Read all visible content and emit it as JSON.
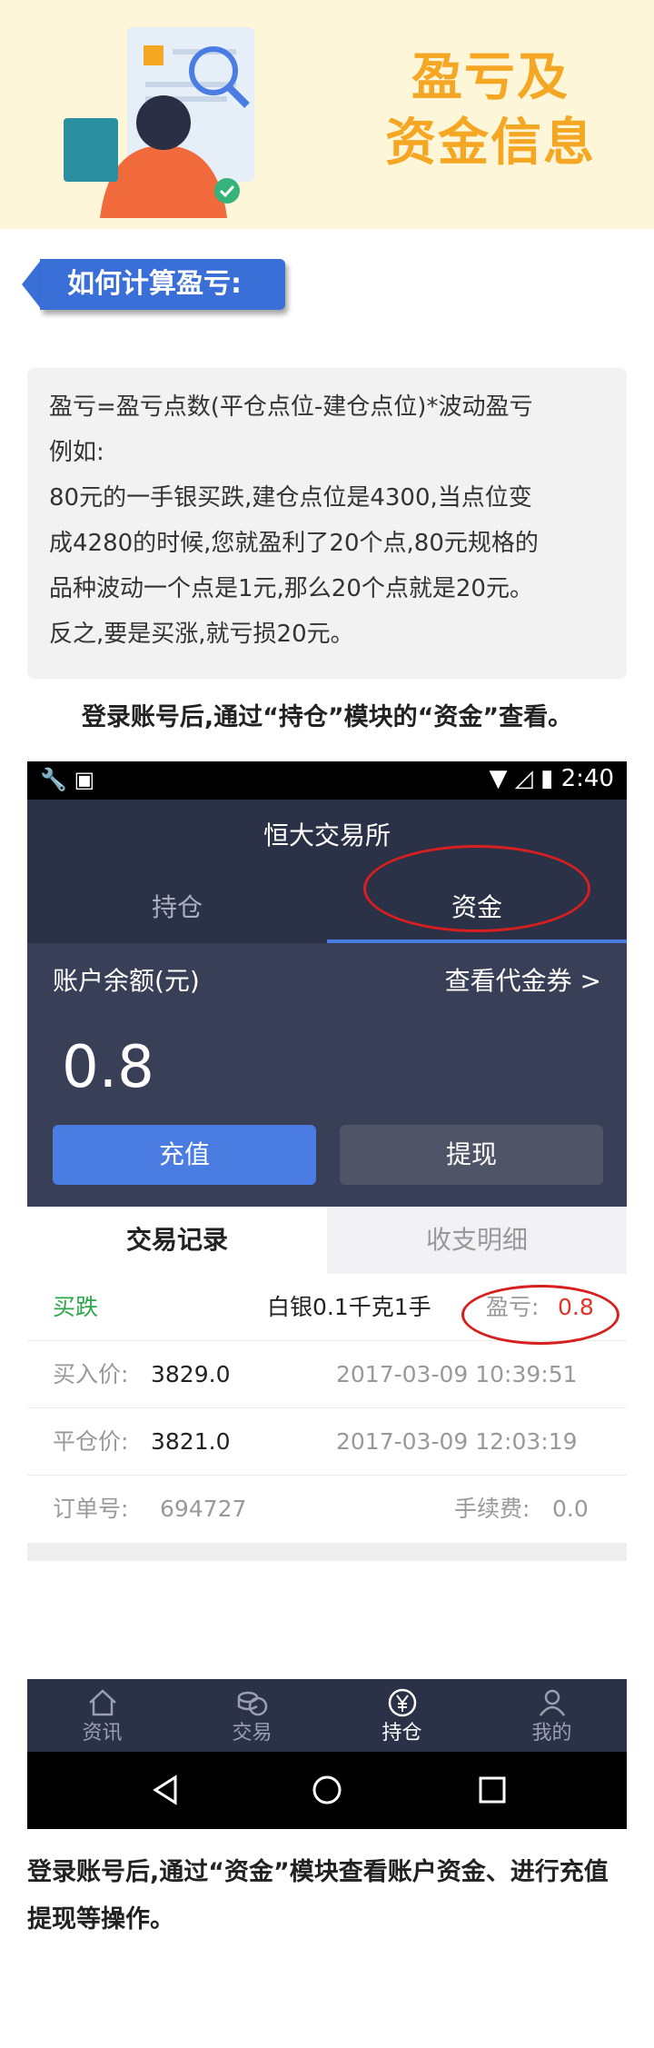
{
  "banner": {
    "title_line1": "盈亏及",
    "title_line2": "资金信息"
  },
  "section": {
    "label": "如何计算盈亏:"
  },
  "explain": {
    "lines": [
      "盈亏=盈亏点数(平仓点位-建仓点位)*波动盈亏",
      "例如:",
      "80元的一手银买跌,建仓点位是4300,当点位变",
      "成4280的时候,您就盈利了20个点,80元规格的",
      "品种波动一个点是1元,那么20个点就是20元。",
      "反之,要是买涨,就亏损20元。"
    ]
  },
  "caption1": "登录账号后,通过“持仓”模块的“资金”查看。",
  "phone": {
    "status": {
      "time": "2:40"
    },
    "app_title": "恒大交易所",
    "tabs": [
      {
        "label": "持仓"
      },
      {
        "label": "资金"
      }
    ],
    "account": {
      "balance_label": "账户余额(元)",
      "voucher_link": "查看代金券 >",
      "balance": "0.8",
      "recharge": "充值",
      "withdraw": "提现"
    },
    "subtabs": [
      {
        "label": "交易记录"
      },
      {
        "label": "收支明细"
      }
    ],
    "record": {
      "direction": "买跌",
      "product": "白银0.1千克1手",
      "pnl_label": "盈亏:",
      "pnl_value": "0.8",
      "buy_label": "买入价:",
      "buy_price": "3829.0",
      "buy_time": "2017-03-09 10:39:51",
      "close_label": "平仓价:",
      "close_price": "3821.0",
      "close_time": "2017-03-09 12:03:19",
      "order_label": "订单号:",
      "order_no": "694727",
      "fee_label": "手续费:",
      "fee": "0.0"
    },
    "nav": [
      {
        "label": "资讯",
        "icon": "home-icon"
      },
      {
        "label": "交易",
        "icon": "coins-icon"
      },
      {
        "label": "持仓",
        "icon": "yen-icon"
      },
      {
        "label": "我的",
        "icon": "user-icon"
      }
    ]
  },
  "caption2": "登录账号后,通过“资金”模块查看账户资金、进行充值提现等操作。"
}
